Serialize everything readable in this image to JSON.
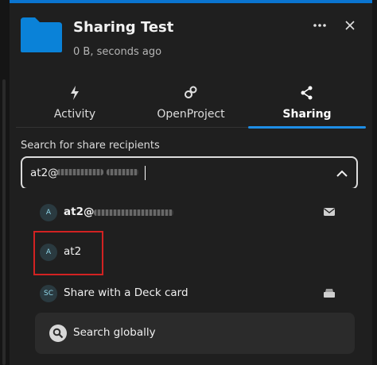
{
  "header": {
    "title": "Sharing Test",
    "subtitle": "0 B, seconds ago",
    "more_icon": "more-horizontal-icon",
    "close_icon": "close-icon",
    "folder_icon": "folder-icon",
    "folder_color": "#0a82d8"
  },
  "tabs": [
    {
      "label": "Activity",
      "icon": "lightning-icon",
      "active": false
    },
    {
      "label": "OpenProject",
      "icon": "openproject-icon",
      "active": false
    },
    {
      "label": "Sharing",
      "icon": "share-icon",
      "active": true
    }
  ],
  "search": {
    "label": "Search for share recipients",
    "value": "at2@",
    "value_obscured": true,
    "dropdown_icon": "chevron-up-icon"
  },
  "options": [
    {
      "avatar": "A",
      "label": "at2@",
      "label_obscured": true,
      "right_icon": "email-icon"
    },
    {
      "avatar": "A",
      "label": "at2",
      "highlighted": true
    },
    {
      "avatar": "SC",
      "label": "Share with a Deck card",
      "right_icon": "deck-icon"
    }
  ],
  "search_globally": {
    "label": "Search globally",
    "icon": "magnify-icon"
  },
  "colors": {
    "accent": "#1e8ee6",
    "highlight": "#d22222"
  }
}
